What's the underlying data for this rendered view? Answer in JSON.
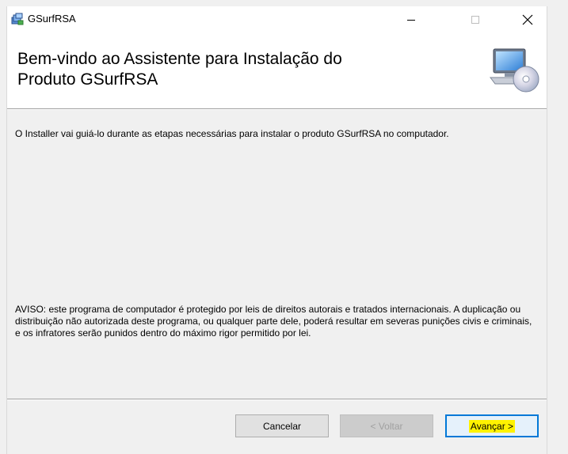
{
  "window": {
    "title": "GSurfRSA",
    "app_icon": "installer-icon",
    "controls": {
      "minimize": "minimize-icon",
      "maximize": "maximize-icon",
      "close": "close-icon"
    }
  },
  "header": {
    "title": "Bem-vindo ao Assistente para Instalação do\nProduto GSurfRSA",
    "graphic": "computer-cd-icon"
  },
  "content": {
    "intro": "O Installer vai guiá-lo durante as etapas necessárias para instalar o produto GSurfRSA no computador.",
    "warning": "AVISO: este programa de computador é protegido por leis de direitos autorais e tratados internacionais. A duplicação ou distribuição não autorizada deste programa, ou qualquer parte dele, poderá resultar em severas punições civis e criminais, e os infratores serão punidos dentro do máximo rigor permitido por lei."
  },
  "buttons": {
    "cancel": "Cancelar",
    "back": "< Voltar",
    "back_enabled": false,
    "next": "Avançar >",
    "next_highlight_color": "#fff200"
  },
  "colors": {
    "accent": "#0078d7",
    "background": "#f0f0f0",
    "header_background": "#ffffff"
  }
}
